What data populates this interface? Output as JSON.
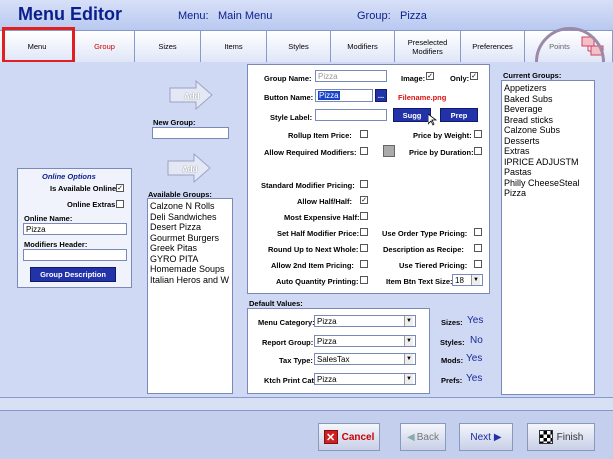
{
  "header": {
    "title": "Menu Editor",
    "menu_label": "Menu:",
    "menu_value": "Main Menu",
    "group_label": "Group:",
    "group_value": "Pizza"
  },
  "tabs": [
    {
      "label": "Menu"
    },
    {
      "label": "Group"
    },
    {
      "label": "Sizes"
    },
    {
      "label": "Items"
    },
    {
      "label": "Styles"
    },
    {
      "label": "Modifiers"
    },
    {
      "label": "Preselected Modifiers"
    },
    {
      "label": "Preferences"
    },
    {
      "label": "Points"
    }
  ],
  "left": {
    "add_label": "Add",
    "add2_label": "Add",
    "new_group_label": "New Group:",
    "new_group_value": "",
    "online_title": "Online Options",
    "is_available_online_label": "Is Available Online",
    "is_available_online_checked": "✓",
    "online_extras_label": "Online Extras",
    "online_extras_checked": "",
    "online_name_label": "Online Name:",
    "online_name_value": "Pizza",
    "modifiers_header_label": "Modifiers Header:",
    "modifiers_header_value": "",
    "group_description_button": "Group Description",
    "available_groups_label": "Available Groups:",
    "available_groups": [
      "Calzone N Rolls",
      "Deli Sandwiches",
      "Desert Pizza",
      "Gourmet Burgers",
      "Greek Pitas",
      "GYRO PITA",
      "Homemade Soups",
      "Italian Heros and W"
    ]
  },
  "form": {
    "group_name_label": "Group Name:",
    "group_name_placeholder": "Pizza",
    "image_label": "Image:",
    "image_checked": "✓",
    "only_label": "Only:",
    "only_checked": "✓",
    "button_name_label": "Button Name:",
    "button_name_value": "Pizza",
    "browse_label": "...",
    "filename_label": "Filename.png",
    "style_label_label": "Style Label:",
    "style_label_value": "",
    "sugg_button": "Sugg",
    "prep_button": "Prep",
    "rollup_label": "Rollup Item Price:",
    "price_by_weight_label": "Price by Weight:",
    "allow_required_label": "Allow Required Modifiers:",
    "price_by_duration_label": "Price by Duration:",
    "standard_mod_label": "Standard Modifier Pricing:",
    "allow_half_label": "Allow Half/Half:",
    "allow_half_checked": "✓",
    "most_expensive_label": "Most Expensive Half:",
    "set_half_label": "Set Half Modifier Price:",
    "use_order_type_label": "Use Order Type Pricing:",
    "round_up_label": "Round Up to Next Whole:",
    "desc_as_recipe_label": "Description as Recipe:",
    "allow_2nd_label": "Allow 2nd Item Pricing:",
    "use_tiered_label": "Use Tiered Pricing:",
    "auto_qty_label": "Auto Quantity Printing:",
    "item_btn_text_size_label": "Item Btn Text Size:",
    "item_btn_text_size_value": "18"
  },
  "defaults": {
    "title": "Default Values:",
    "menu_category_label": "Menu Category:",
    "menu_category_value": "Pizza",
    "report_group_label": "Report Group:",
    "report_group_value": "Pizza",
    "tax_type_label": "Tax Type:",
    "tax_type_value": "SalesTax",
    "ktch_print_label": "Ktch Print Cat:",
    "ktch_print_value": "Pizza"
  },
  "summary": {
    "sizes_label": "Sizes:",
    "sizes_value": "Yes",
    "styles_label": "Styles:",
    "styles_value": "No",
    "mods_label": "Mods:",
    "mods_value": "Yes",
    "prefs_label": "Prefs:",
    "prefs_value": "Yes"
  },
  "current_groups": {
    "label": "Current Groups:",
    "items": [
      "Appetizers",
      "Baked Subs",
      "Beverage",
      "Bread sticks",
      "Calzone Subs",
      "Desserts",
      "Extras",
      "IPRICE ADJUSTM",
      "Pastas",
      "Philly CheeseSteal",
      "Pizza"
    ]
  },
  "footer": {
    "cancel": "Cancel",
    "back": "Back",
    "next": "Next",
    "finish": "Finish"
  },
  "colors": {
    "accent": "#0a1e8c",
    "highlight_red": "#e02020",
    "active_tab": "#cc0000"
  }
}
